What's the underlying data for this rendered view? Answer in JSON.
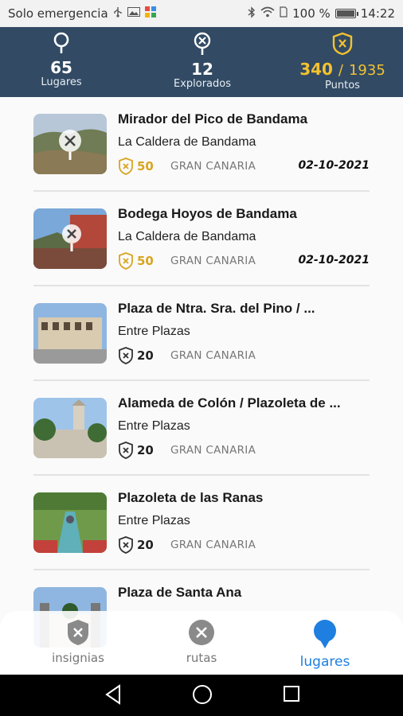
{
  "statusbar": {
    "carrier": "Solo emergencia",
    "battery_text": "100 %",
    "time": "14:22",
    "battery_level": 1.0
  },
  "header": {
    "lugares": {
      "value": "65",
      "label": "Lugares"
    },
    "explorados": {
      "value": "12",
      "label": "Explorados"
    },
    "puntos": {
      "earned": "340",
      "separator": "/",
      "total": "1935",
      "label": "Puntos"
    }
  },
  "places": [
    {
      "title": "Mirador del Pico de Bandama",
      "subtitle": "La Caldera de Bandama",
      "points": "50",
      "region": "GRAN CANARIA",
      "date": "02-10-2021",
      "visited": true
    },
    {
      "title": "Bodega Hoyos de Bandama",
      "subtitle": "La Caldera de Bandama",
      "points": "50",
      "region": "GRAN CANARIA",
      "date": "02-10-2021",
      "visited": true
    },
    {
      "title": "Plaza de Ntra. Sra. del Pino / ...",
      "subtitle": "Entre Plazas",
      "points": "20",
      "region": "GRAN CANARIA",
      "date": "",
      "visited": false
    },
    {
      "title": "Alameda de Colón / Plazoleta de ...",
      "subtitle": "Entre Plazas",
      "points": "20",
      "region": "GRAN CANARIA",
      "date": "",
      "visited": false
    },
    {
      "title": "Plazoleta de las Ranas",
      "subtitle": "Entre Plazas",
      "points": "20",
      "region": "GRAN CANARIA",
      "date": "",
      "visited": false
    },
    {
      "title": "Plaza de Santa Ana",
      "subtitle": "",
      "points": "",
      "region": "",
      "date": "",
      "visited": false
    }
  ],
  "bottomnav": {
    "insignias": "insignias",
    "rutas": "rutas",
    "lugares": "lugares",
    "active": "lugares"
  },
  "colors": {
    "header_bg": "#324a63",
    "accent_gold": "#f2c230",
    "active_blue": "#1e7fe0"
  }
}
